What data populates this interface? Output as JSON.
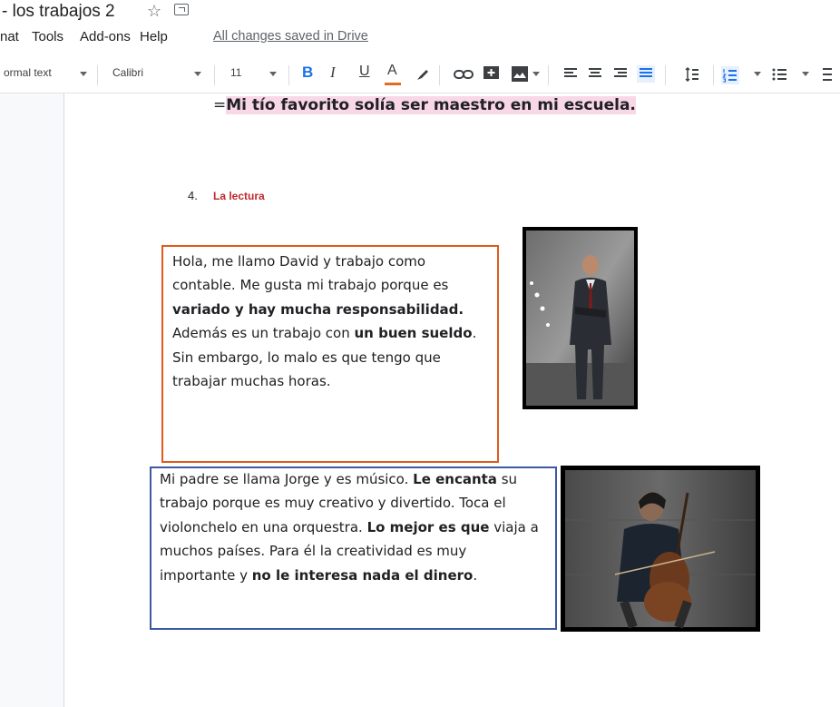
{
  "title_bar": {
    "doc_title": "- los trabajos 2"
  },
  "menu": {
    "items": [
      "nat",
      "Tools",
      "Add-ons",
      "Help"
    ],
    "saved_status": "All changes saved in Drive"
  },
  "toolbar": {
    "style": "ormal text",
    "font": "Calibri",
    "size": "11",
    "bold": "B",
    "italic": "I",
    "underline": "U",
    "text_color": "A"
  },
  "doc": {
    "line_prefix": "=",
    "highlight_sentence": "Mi tío favorito solía ser maestro en mi escuela.",
    "list_number": "4.",
    "list_item": "La lectura",
    "para1": {
      "t1": "Hola, me llamo David y trabajo como contable. Me gusta mi trabajo porque es ",
      "b1": "variado y hay mucha responsabilidad.",
      "t2": " Además es un trabajo con ",
      "b2": "un buen sueldo",
      "t3": ". Sin embargo, lo malo es que tengo que trabajar muchas horas."
    },
    "para2": {
      "t1": "Mi padre se llama Jorge y es músico. ",
      "b1": "Le encanta",
      "t2": " su trabajo porque es muy creativo y divertido. Toca el violonchelo en una orquestra. ",
      "b2": "Lo mejor es que",
      "t3": " viaja a muchos países. Para él la creatividad es muy importante y ",
      "b3": "no le interesa nada el dinero",
      "t4": "."
    }
  },
  "colors": {
    "box1_border": "#e05a1c",
    "box2_border": "#3c5aa0",
    "highlight": "#f8d7e7",
    "list_item": "#c0272d",
    "accent": "#1a73e8"
  }
}
